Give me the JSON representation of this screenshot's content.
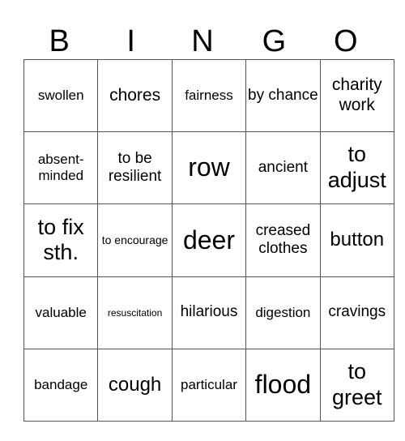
{
  "header": {
    "letters": [
      "B",
      "I",
      "N",
      "G",
      "O"
    ]
  },
  "rows": [
    [
      "swollen",
      "chores",
      "fairness",
      "by chance",
      "charity work"
    ],
    [
      "absent-minded",
      "to be resilient",
      "row",
      "ancient",
      "to adjust"
    ],
    [
      "to fix sth.",
      "to encourage",
      "deer",
      "creased clothes",
      "button"
    ],
    [
      "valuable",
      "resuscitation",
      "hilarious",
      "digestion",
      "cravings"
    ],
    [
      "bandage",
      "cough",
      "particular",
      "flood",
      "to greet"
    ]
  ]
}
